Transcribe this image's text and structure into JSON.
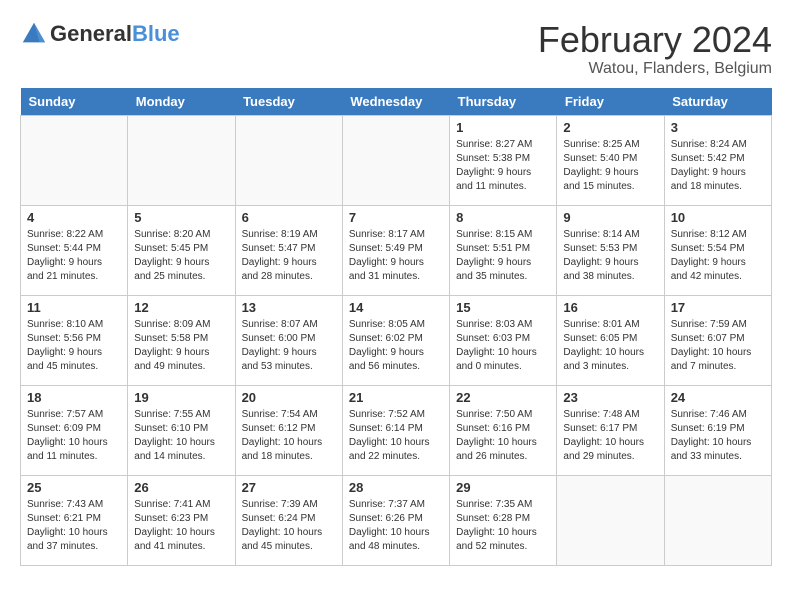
{
  "header": {
    "logo_general": "General",
    "logo_blue": "Blue",
    "month_title": "February 2024",
    "location": "Watou, Flanders, Belgium"
  },
  "weekdays": [
    "Sunday",
    "Monday",
    "Tuesday",
    "Wednesday",
    "Thursday",
    "Friday",
    "Saturday"
  ],
  "weeks": [
    [
      {
        "day": "",
        "info": ""
      },
      {
        "day": "",
        "info": ""
      },
      {
        "day": "",
        "info": ""
      },
      {
        "day": "",
        "info": ""
      },
      {
        "day": "1",
        "info": "Sunrise: 8:27 AM\nSunset: 5:38 PM\nDaylight: 9 hours\nand 11 minutes."
      },
      {
        "day": "2",
        "info": "Sunrise: 8:25 AM\nSunset: 5:40 PM\nDaylight: 9 hours\nand 15 minutes."
      },
      {
        "day": "3",
        "info": "Sunrise: 8:24 AM\nSunset: 5:42 PM\nDaylight: 9 hours\nand 18 minutes."
      }
    ],
    [
      {
        "day": "4",
        "info": "Sunrise: 8:22 AM\nSunset: 5:44 PM\nDaylight: 9 hours\nand 21 minutes."
      },
      {
        "day": "5",
        "info": "Sunrise: 8:20 AM\nSunset: 5:45 PM\nDaylight: 9 hours\nand 25 minutes."
      },
      {
        "day": "6",
        "info": "Sunrise: 8:19 AM\nSunset: 5:47 PM\nDaylight: 9 hours\nand 28 minutes."
      },
      {
        "day": "7",
        "info": "Sunrise: 8:17 AM\nSunset: 5:49 PM\nDaylight: 9 hours\nand 31 minutes."
      },
      {
        "day": "8",
        "info": "Sunrise: 8:15 AM\nSunset: 5:51 PM\nDaylight: 9 hours\nand 35 minutes."
      },
      {
        "day": "9",
        "info": "Sunrise: 8:14 AM\nSunset: 5:53 PM\nDaylight: 9 hours\nand 38 minutes."
      },
      {
        "day": "10",
        "info": "Sunrise: 8:12 AM\nSunset: 5:54 PM\nDaylight: 9 hours\nand 42 minutes."
      }
    ],
    [
      {
        "day": "11",
        "info": "Sunrise: 8:10 AM\nSunset: 5:56 PM\nDaylight: 9 hours\nand 45 minutes."
      },
      {
        "day": "12",
        "info": "Sunrise: 8:09 AM\nSunset: 5:58 PM\nDaylight: 9 hours\nand 49 minutes."
      },
      {
        "day": "13",
        "info": "Sunrise: 8:07 AM\nSunset: 6:00 PM\nDaylight: 9 hours\nand 53 minutes."
      },
      {
        "day": "14",
        "info": "Sunrise: 8:05 AM\nSunset: 6:02 PM\nDaylight: 9 hours\nand 56 minutes."
      },
      {
        "day": "15",
        "info": "Sunrise: 8:03 AM\nSunset: 6:03 PM\nDaylight: 10 hours\nand 0 minutes."
      },
      {
        "day": "16",
        "info": "Sunrise: 8:01 AM\nSunset: 6:05 PM\nDaylight: 10 hours\nand 3 minutes."
      },
      {
        "day": "17",
        "info": "Sunrise: 7:59 AM\nSunset: 6:07 PM\nDaylight: 10 hours\nand 7 minutes."
      }
    ],
    [
      {
        "day": "18",
        "info": "Sunrise: 7:57 AM\nSunset: 6:09 PM\nDaylight: 10 hours\nand 11 minutes."
      },
      {
        "day": "19",
        "info": "Sunrise: 7:55 AM\nSunset: 6:10 PM\nDaylight: 10 hours\nand 14 minutes."
      },
      {
        "day": "20",
        "info": "Sunrise: 7:54 AM\nSunset: 6:12 PM\nDaylight: 10 hours\nand 18 minutes."
      },
      {
        "day": "21",
        "info": "Sunrise: 7:52 AM\nSunset: 6:14 PM\nDaylight: 10 hours\nand 22 minutes."
      },
      {
        "day": "22",
        "info": "Sunrise: 7:50 AM\nSunset: 6:16 PM\nDaylight: 10 hours\nand 26 minutes."
      },
      {
        "day": "23",
        "info": "Sunrise: 7:48 AM\nSunset: 6:17 PM\nDaylight: 10 hours\nand 29 minutes."
      },
      {
        "day": "24",
        "info": "Sunrise: 7:46 AM\nSunset: 6:19 PM\nDaylight: 10 hours\nand 33 minutes."
      }
    ],
    [
      {
        "day": "25",
        "info": "Sunrise: 7:43 AM\nSunset: 6:21 PM\nDaylight: 10 hours\nand 37 minutes."
      },
      {
        "day": "26",
        "info": "Sunrise: 7:41 AM\nSunset: 6:23 PM\nDaylight: 10 hours\nand 41 minutes."
      },
      {
        "day": "27",
        "info": "Sunrise: 7:39 AM\nSunset: 6:24 PM\nDaylight: 10 hours\nand 45 minutes."
      },
      {
        "day": "28",
        "info": "Sunrise: 7:37 AM\nSunset: 6:26 PM\nDaylight: 10 hours\nand 48 minutes."
      },
      {
        "day": "29",
        "info": "Sunrise: 7:35 AM\nSunset: 6:28 PM\nDaylight: 10 hours\nand 52 minutes."
      },
      {
        "day": "",
        "info": ""
      },
      {
        "day": "",
        "info": ""
      }
    ]
  ]
}
